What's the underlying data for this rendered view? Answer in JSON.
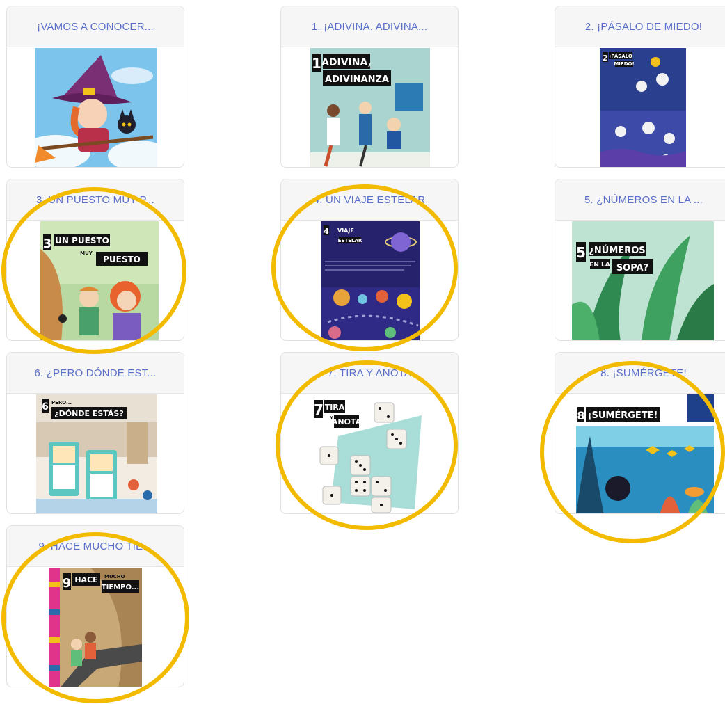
{
  "cards": [
    {
      "title": "¡VAMOS A CONOCER..."
    },
    {
      "title": "1. ¡ADIVINA. ADIVINA..."
    },
    {
      "title": "2. ¡PÁSALO DE MIEDO!"
    },
    {
      "title": "3. UN PUESTO MUY P..."
    },
    {
      "title": "4. UN VIAJE ESTELAR"
    },
    {
      "title": "5. ¿NÚMEROS EN LA ..."
    },
    {
      "title": "6. ¿PERO DÓNDE EST..."
    },
    {
      "title": "7. TIRA Y ANOTA"
    },
    {
      "title": "8. ¡SUMÉRGETE!"
    },
    {
      "title": "9. HACE MUCHO TIE..."
    }
  ],
  "covers": {
    "c1": [
      "1",
      "ADIVINA,",
      "ADIVINANZA"
    ],
    "c2": [
      "2",
      "¡PÁSALO",
      "MIEDO!"
    ],
    "c3": [
      "3",
      "UN PUESTO",
      "MUY",
      "PUESTO"
    ],
    "c4": [
      "4",
      "VIAJE",
      "ESTELAR"
    ],
    "c5": [
      "5",
      "¿NÚMEROS",
      "EN LA",
      "SOPA?"
    ],
    "c6": [
      "6",
      "PERO...",
      "¿DÓNDE ESTÁS?"
    ],
    "c7": [
      "7",
      "TIRA",
      "Y",
      "ANOTA"
    ],
    "c8": [
      "8",
      "¡SUMÉRGETE!"
    ],
    "c9": [
      "9",
      "HACE",
      "MUCHO",
      "TIEMPO..."
    ]
  },
  "colors": {
    "title": "#5a6fc9",
    "highlight_ring": "#f3bb00",
    "card_border": "#e2e2e2"
  }
}
